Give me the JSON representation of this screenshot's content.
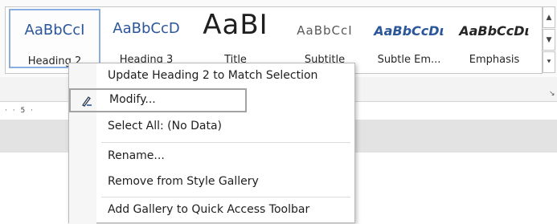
{
  "styles_gallery": {
    "items": [
      {
        "preview": "AaBbCcI",
        "name": "Heading 2"
      },
      {
        "preview": "AaBbCcD",
        "name": "Heading 3"
      },
      {
        "preview": "AaBI",
        "name": "Title"
      },
      {
        "preview": "AaBbCcI",
        "name": "Subtitle"
      },
      {
        "preview": "AaBbCcDι",
        "name": "Subtle Em..."
      },
      {
        "preview": "AaBbCcDι",
        "name": "Emphasis"
      }
    ],
    "scroll_up": "▲",
    "scroll_down": "▼",
    "more": "⯆"
  },
  "ribbon": {
    "launcher": "↘"
  },
  "ruler": {
    "text": "· · 5 ·"
  },
  "context_menu": {
    "items": [
      {
        "label": "Update Heading 2 to Match Selection"
      },
      {
        "label": "Modify..."
      },
      {
        "label": "Select All: (No Data)"
      },
      {
        "label": "Rename..."
      },
      {
        "label": "Remove from Style Gallery"
      },
      {
        "label": "Add Gallery to Quick Access Toolbar"
      }
    ]
  }
}
